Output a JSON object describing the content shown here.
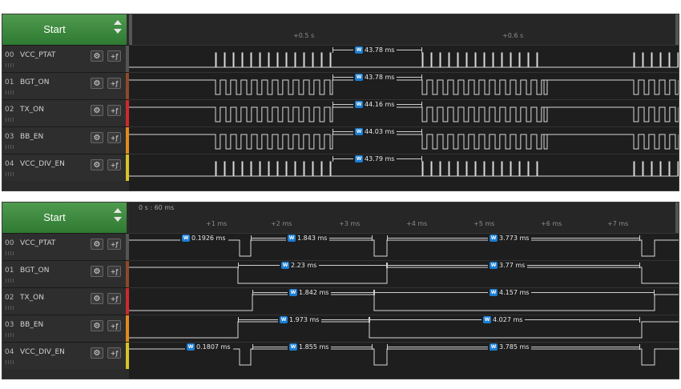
{
  "colors": {
    "ch0": "#555555",
    "ch1": "#8b4a2a",
    "ch2": "#cc2b2b",
    "ch3": "#e08a1e",
    "ch4": "#d8c22a"
  },
  "channels": [
    {
      "num": "00",
      "name": "VCC_PTAT",
      "gear_icon": "gear-icon",
      "trigger_label": "+ƒ"
    },
    {
      "num": "01",
      "name": "BGT_ON",
      "gear_icon": "gear-icon",
      "trigger_label": "+ƒ"
    },
    {
      "num": "02",
      "name": "TX_ON",
      "gear_icon": "gear-icon",
      "trigger_label": "+ƒ"
    },
    {
      "num": "03",
      "name": "BB_EN",
      "gear_icon": "gear-icon",
      "trigger_label": "+ƒ"
    },
    {
      "num": "04",
      "name": "VCC_DIV_EN",
      "gear_icon": "gear-icon",
      "trigger_label": "+ƒ"
    }
  ],
  "top": {
    "start_label": "Start",
    "ticks": [
      "+0.5 s",
      "+0.6 s"
    ],
    "measurements": [
      "43.78 ms",
      "43.78 ms",
      "44.16 ms",
      "44.03 ms",
      "43.79 ms"
    ]
  },
  "bottom": {
    "start_label": "Start",
    "time_readout": "0 s : 60 ms",
    "ticks": [
      "+1 ms",
      "+2 ms",
      "+3 ms",
      "+4 ms",
      "+5 ms",
      "+6 ms",
      "+7 ms"
    ],
    "measurements": {
      "ch0": [
        "0.1926 ms",
        "1.843 ms",
        "3.773 ms"
      ],
      "ch1": [
        "2.23 ms",
        "3.77 ms"
      ],
      "ch2": [
        "1.842 ms",
        "4.157 ms"
      ],
      "ch3": [
        "1.973 ms",
        "4.027 ms"
      ],
      "ch4": [
        "0.1807 ms",
        "1.855 ms",
        "3.785 ms"
      ]
    }
  }
}
